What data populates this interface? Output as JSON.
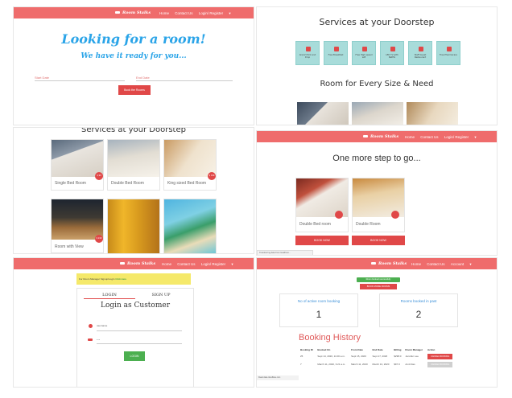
{
  "colors": {
    "brand": "#ef6c6c",
    "accent": "#e04848",
    "teal": "#a8dcda",
    "blue_heading": "#2aa4e8",
    "green": "#4caf50",
    "yellow": "#f5e96a"
  },
  "nav": {
    "brand": "Room Stalks",
    "links": [
      "Home",
      "Contact Us",
      "Login/ Register"
    ],
    "links_user": [
      "Home",
      "Contact Us",
      "Account"
    ]
  },
  "hero": {
    "title": "Looking for a room!",
    "subtitle": "We have it ready for you...",
    "start_placeholder": "Start Date",
    "end_placeholder": "End Date",
    "search_button": "Book the Rooms"
  },
  "services": {
    "heading": "Services at your Doorstep",
    "items": [
      {
        "icon": "plane-icon",
        "label": "Airport Pick and Drop"
      },
      {
        "icon": "coffee-icon",
        "label": "Free Breakfast"
      },
      {
        "icon": "wifi-icon",
        "label": "Free High speed wifi"
      },
      {
        "icon": "tv-icon",
        "label": "LED TV with Netflix"
      },
      {
        "icon": "food-icon",
        "label": "Staff Guest Restaurant"
      },
      {
        "icon": "medical-icon",
        "label": "Free Pharmacare"
      }
    ]
  },
  "rooms_section": {
    "heading": "Room for Every Size & Need"
  },
  "rooms": [
    {
      "name": "Single Bed Room",
      "badge": "$ 99"
    },
    {
      "name": "Double Bed Room",
      "badge": "$ 149"
    },
    {
      "name": "King sized Bed Room",
      "badge": "$ 199"
    },
    {
      "name": "Room with View",
      "badge": "$ 249"
    },
    {
      "name": "",
      "badge": ""
    },
    {
      "name": "",
      "badge": ""
    }
  ],
  "checkout": {
    "heading": "One more step to go...",
    "cards": [
      {
        "name": "Double Bed room",
        "button": "BOOK NOW"
      },
      {
        "name": "Double Room",
        "button": "BOOK NOW"
      }
    ],
    "status": "Transferring data from localhost..."
  },
  "login": {
    "banner": "For Room Manager Signup/Login",
    "banner_link": "Click Here",
    "tab_login": "LOGIN",
    "tab_signup": "SIGN UP",
    "heading": "Login as Customer",
    "username_value": "username",
    "password_value": "...",
    "button": "LOGIN"
  },
  "dashboard": {
    "success_msg": "Room booked successfully",
    "book_more_button": "BOOK MORE ROOMS",
    "stat1_label": "No of active room booking",
    "stat1_value": "1",
    "stat2_label": "Rooms booked in past",
    "stat2_value": "2",
    "history_heading": "Booking History",
    "columns": [
      "Booking ID",
      "Booked On",
      "From Date",
      "End Date",
      "Billing",
      "Room Manager",
      "Action"
    ],
    "rows": [
      [
        "25",
        "Sept 14, 2020, 11:00 a.m.",
        "Sept 15, 2020",
        "Sept 17, 2020",
        "$298.0",
        "Jennifer Lee",
        "CANCEL BOOKING"
      ],
      [
        "7",
        "March 11, 2020, 3:21 a.m.",
        "March 11, 2020",
        "March 13, 2020",
        "$97.0",
        "Amit Das",
        "CANCEL BOOKING"
      ]
    ],
    "status": "Read data.cloudflare.com"
  }
}
